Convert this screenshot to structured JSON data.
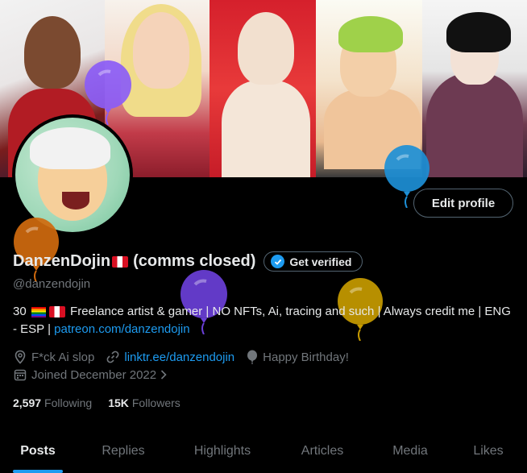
{
  "profile": {
    "display_name": "DanzenDojin",
    "name_suffix": "(comms closed)",
    "handle": "@danzendojin",
    "edit_profile_label": "Edit profile",
    "get_verified_label": "Get verified",
    "bio_prefix": "30",
    "bio_text": "Freelance artist & gamer | NO NFTs, Ai, tracing and such | Always credit me | ENG - ESP |",
    "bio_link": "patreon.com/danzendojin",
    "location": "F*ck Ai slop",
    "website": "linktr.ee/danzendojin",
    "birthday": "Happy Birthday!",
    "joined": "Joined December 2022",
    "following_count": "2,597",
    "following_label": "Following",
    "followers_count": "15K",
    "followers_label": "Followers"
  },
  "tabs": [
    {
      "label": "Posts",
      "active": true
    },
    {
      "label": "Replies",
      "active": false
    },
    {
      "label": "Highlights",
      "active": false
    },
    {
      "label": "Articles",
      "active": false
    },
    {
      "label": "Media",
      "active": false
    },
    {
      "label": "Likes",
      "active": false
    }
  ],
  "colors": {
    "accent": "#1d9bf0",
    "muted": "#71767b",
    "text": "#e7e9ea",
    "background": "#000000"
  },
  "balloon_colors": [
    "#8b5cf6",
    "#1d8fd6",
    "#d06a0e",
    "#6a3fd8",
    "#c79b00"
  ]
}
